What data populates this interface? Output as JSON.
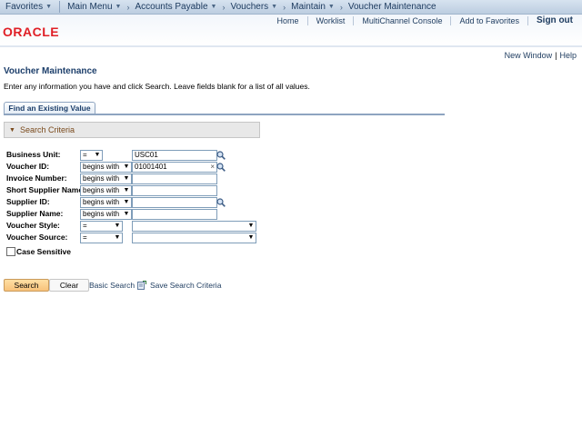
{
  "nav": {
    "favorites": "Favorites",
    "main_menu": "Main Menu",
    "accounts_payable": "Accounts Payable",
    "vouchers": "Vouchers",
    "maintain": "Maintain",
    "voucher_maintenance": "Voucher Maintenance"
  },
  "header": {
    "logo": "ORACLE",
    "home": "Home",
    "worklist": "Worklist",
    "multichannel": "MultiChannel Console",
    "add_favorites": "Add to Favorites",
    "sign_out": "Sign out"
  },
  "window_links": {
    "new_window": "New Window",
    "separator": "|",
    "help": "Help"
  },
  "page": {
    "title": "Voucher Maintenance",
    "instructions": "Enter any information you have and click Search. Leave fields blank for a list of all values.",
    "tab": "Find an Existing Value",
    "criteria_header": "Search Criteria"
  },
  "fields": {
    "business_unit": {
      "label": "Business Unit:",
      "operator": "=",
      "value": "USC01"
    },
    "voucher_id": {
      "label": "Voucher ID:",
      "operator": "begins with",
      "value": "01001401",
      "clear": "×"
    },
    "invoice_number": {
      "label": "Invoice Number:",
      "operator": "begins with",
      "value": ""
    },
    "short_supplier_name": {
      "label": "Short Supplier Name:",
      "operator": "begins with",
      "value": ""
    },
    "supplier_id": {
      "label": "Supplier ID:",
      "operator": "begins with",
      "value": ""
    },
    "supplier_name": {
      "label": "Supplier Name:",
      "operator": "begins with",
      "value": ""
    },
    "voucher_style": {
      "label": "Voucher Style:",
      "operator": "=",
      "value": ""
    },
    "voucher_source": {
      "label": "Voucher Source:",
      "operator": "=",
      "value": ""
    },
    "case_sensitive": {
      "label": "Case Sensitive",
      "checked": false
    }
  },
  "actions": {
    "search": "Search",
    "clear": "Clear",
    "basic_search": "Basic Search",
    "save_search": "Save Search Criteria"
  },
  "colors": {
    "brand_red": "#e01f26",
    "link_blue": "#1c3a5e",
    "search_button": "#f8c27a"
  }
}
